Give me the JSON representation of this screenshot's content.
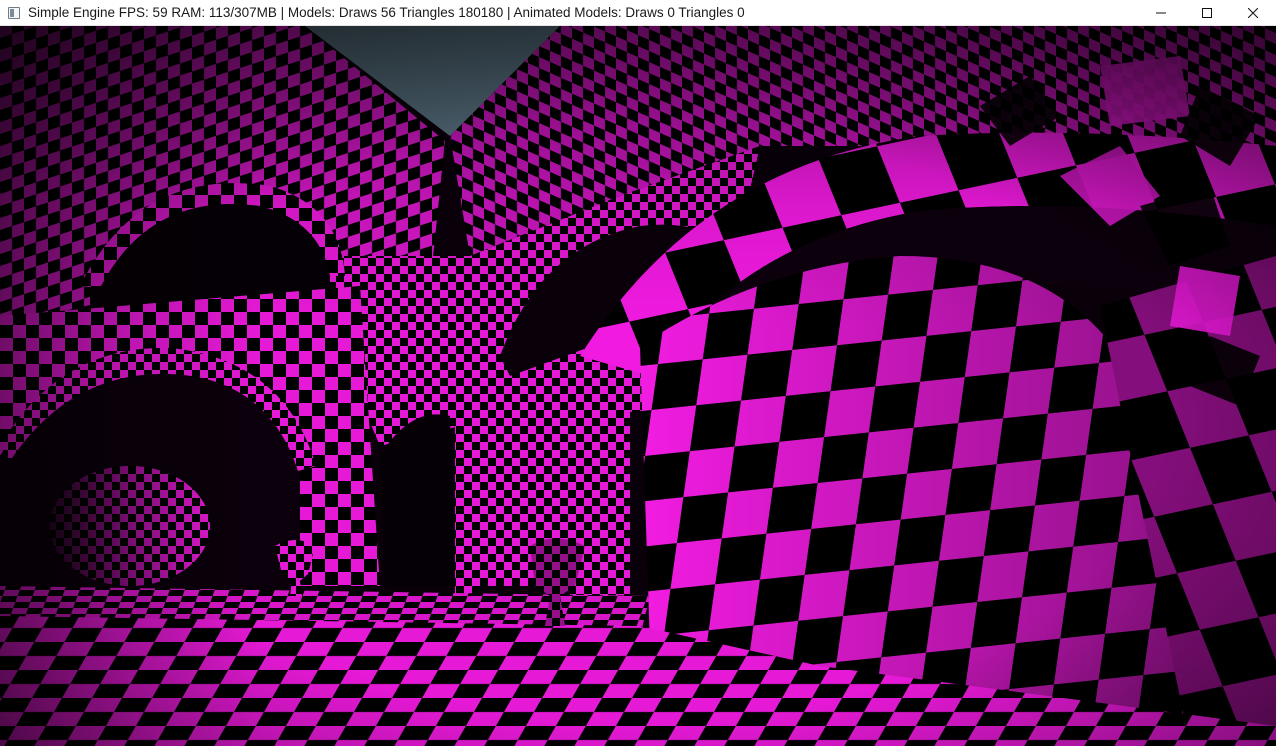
{
  "window": {
    "title": "Simple Engine FPS: 59 RAM: 113/307MB | Models: Draws 56 Triangles 180180 | Animated Models: Draws 0 Triangles 0",
    "icon": "app-window-icon",
    "controls": {
      "minimize_icon": "minimize-icon",
      "maximize_icon": "maximize-icon",
      "close_icon": "close-icon"
    }
  },
  "scene": {
    "description_icon": "render-viewport",
    "colors": {
      "checker_magenta": "#e619d6",
      "checker_black": "#000000",
      "sky": "#5e7888",
      "shadow": "#1a0018"
    }
  }
}
